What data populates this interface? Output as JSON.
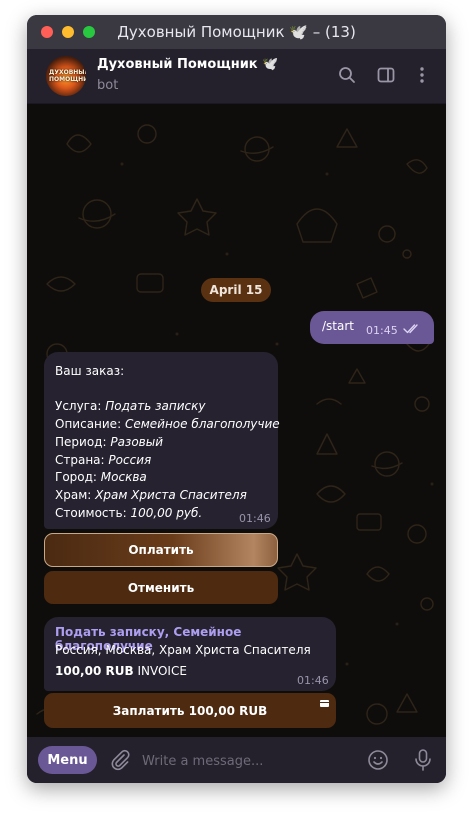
{
  "window": {
    "title": "Духовный Помощник 🕊️ – (13)"
  },
  "header": {
    "avatar_text": "ДУХОВНЫЙ ПОМОЩНИК",
    "chat_name": "Духовный Помощник 🕊️",
    "chat_status": "bot",
    "icons": [
      "search-icon",
      "sidebar-toggle-icon",
      "more-vertical-icon"
    ]
  },
  "chat": {
    "date_separator": "April 15",
    "outgoing": {
      "text": "/start",
      "time": "01:45"
    },
    "order": {
      "intro": "Ваш заказ:",
      "service_label": "Услуга:",
      "service_value": "Подать записку",
      "desc_label": "Описание:",
      "desc_value": "Семейное благополучие",
      "period_label": "Период:",
      "period_value": "Разовый",
      "country_label": "Страна:",
      "country_value": "Россия",
      "city_label": "Город:",
      "city_value": "Москва",
      "temple_label": "Храм:",
      "temple_value": "Храм Христа Спасителя",
      "cost_label": "Стоимость:",
      "cost_value": "100,00 руб.",
      "time": "01:46"
    },
    "keyboard": {
      "pay": "Оплатить",
      "cancel": "Отменить"
    },
    "invoice": {
      "title": "Подать записку, Семейное благополучие",
      "address": "Россия, Москва, Храм Христа Спасителя",
      "amount": "100,00 RUB",
      "type": "INVOICE",
      "time": "01:46",
      "pay_button": "Заплатить 100,00 RUB"
    }
  },
  "input_bar": {
    "menu_label": "Menu",
    "placeholder": "Write a message..."
  },
  "colors": {
    "accent": "#6a5796",
    "bubble_in": "#262230",
    "button_brown": "#4d2a10",
    "invoice_title": "#ae9ef0",
    "chat_bg": "#0f0d0b"
  }
}
